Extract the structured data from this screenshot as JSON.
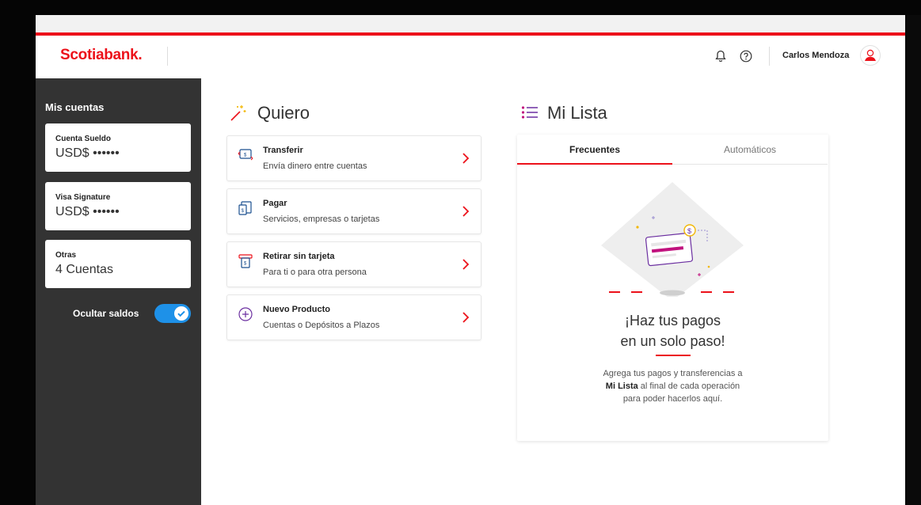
{
  "header": {
    "logo": "Scotiabank.",
    "user_name": "Carlos Mendoza"
  },
  "icons": {
    "bell": "bell-icon",
    "help": "help-circle-icon",
    "avatar": "avatar-icon"
  },
  "sidebar": {
    "title": "Mis cuentas",
    "accounts": [
      {
        "name": "Cuenta Sueldo",
        "value": "USD$ ••••••"
      },
      {
        "name": "Visa Signature",
        "value": "USD$ ••••••"
      },
      {
        "name": "Otras",
        "value": "4 Cuentas"
      }
    ],
    "hide_balances_label": "Ocultar saldos",
    "hide_balances_on": true
  },
  "quiero": {
    "title": "Quiero",
    "actions": [
      {
        "title": "Transferir",
        "subtitle": "Envía dinero entre cuentas",
        "icon": "transfer-icon"
      },
      {
        "title": "Pagar",
        "subtitle": "Servicios, empresas o tarjetas",
        "icon": "pay-icon"
      },
      {
        "title": "Retirar sin tarjeta",
        "subtitle": "Para ti o para otra persona",
        "icon": "atm-withdraw-icon"
      },
      {
        "title": "Nuevo Producto",
        "subtitle": "Cuentas o Depósitos a Plazos",
        "icon": "plus-circle-icon"
      }
    ]
  },
  "mi_lista": {
    "title": "Mi Lista",
    "tabs": [
      "Frecuentes",
      "Automáticos"
    ],
    "active_tab": "Frecuentes",
    "empty_title_line1": "¡Haz tus pagos",
    "empty_title_line2": "en un solo paso!",
    "empty_body_line1": "Agrega tus pagos y transferencias a",
    "empty_body_bold": "Mi Lista",
    "empty_body_line2_rest": " al final de cada operación",
    "empty_body_line3": "para poder hacerlos aquí."
  },
  "colors": {
    "brand_red": "#ec111a",
    "sidebar_bg": "#333333",
    "toggle_blue": "#1e91e8"
  }
}
